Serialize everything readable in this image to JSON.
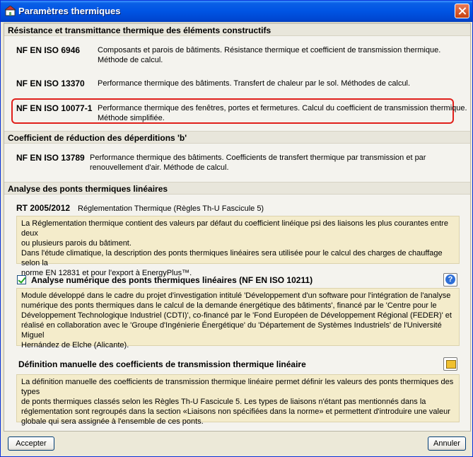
{
  "window": {
    "title": "Paramètres thermiques",
    "icon": "thermal-settings-icon",
    "close_icon": "close-icon"
  },
  "sections": {
    "resistance": {
      "header": "Résistance et transmittance thermique des éléments constructifs",
      "items": [
        {
          "norm": "NF EN ISO 6946",
          "line1": "Composants et parois de bâtiments. Résistance thermique et coefficient de transmission thermique.",
          "line2": "Méthode de calcul."
        },
        {
          "norm": "NF EN ISO 13370",
          "line1": "Performance thermique des bâtiments. Transfert de chaleur par le sol. Méthodes de calcul."
        },
        {
          "norm": "NF EN ISO 10077-1",
          "line1": "Performance thermique des fenêtres, portes et fermetures. Calcul du coefficient de transmission thermique.",
          "line2": "Méthode simplifiée."
        }
      ]
    },
    "reduction": {
      "header": "Coefficient de réduction des déperditions 'b'",
      "items": [
        {
          "norm": "NF EN ISO 13789",
          "line1": "Performance thermique des bâtiments. Coefficients de transfert thermique par transmission et par",
          "line2": "renouvellement d'air. Méthode de calcul."
        }
      ]
    },
    "ponts": {
      "header": "Analyse des ponts thermiques linéaires",
      "rt": {
        "norm": "RT 2005/2012",
        "desc": "Réglementation Thermique (Règles Th-U Fascicule 5)"
      },
      "rt_info": [
        "La Réglementation thermique contient des valeurs par défaut du coefficient linéique psi des liaisons les plus courantes entre deux",
        "ou plusieurs parois du bâtiment.",
        "Dans l'étude climatique, la description des ponts thermiques linéaires sera utilisée pour le calcul des charges de chauffage selon la",
        "norme EN 12831 et pour l'export à EnergyPlus™."
      ],
      "numerical": {
        "label": "Analyse numérique des ponts thermiques linéaires (NF EN ISO 10211)",
        "checked": true,
        "help_label": "?",
        "info": [
          "Module développé dans le cadre du projet d'investigation intitulé 'Développement d'un software pour l'intégration de l'analyse",
          "numérique des ponts thermiques dans le calcul de la demande énergétique des bâtiments', financé par le 'Centre pour le",
          "Développement Technologique Industriel (CDTI)', co-financé par le 'Fond Européen de Développement Régional (FEDER)' et",
          "réalisé en collaboration avec le 'Groupe d'Ingénierie Énergétique' du 'Département de Systèmes Industriels' de l'Université Miguel",
          "Hernández de Elche (Alicante)."
        ]
      },
      "manual": {
        "label": "Définition manuelle des coefficients de transmission thermique linéaire",
        "info": [
          "La définition manuelle des coefficients de transmission thermique linéaire permet définir les valeurs des ponts thermiques des types",
          "de ponts thermiques classés selon les Règles Th-U Fascicule 5. Les types de liaisons n'étant pas mentionnés dans la",
          "réglementation sont regroupés dans la section «Liaisons non spécifiées dans la norme» et permettent d'introduire une valeur",
          "globale qui sera assignée à l'ensemble de ces ponts."
        ]
      }
    }
  },
  "buttons": {
    "accept": "Accepter",
    "cancel": "Annuler"
  },
  "colors": {
    "highlight": "#e0201b",
    "info_bg": "#f4eccb",
    "titlebar": "#0054e3"
  }
}
